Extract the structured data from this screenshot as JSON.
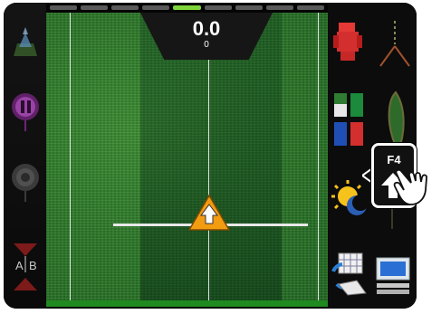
{
  "status": {
    "speed_value": "0.0",
    "speed_sub": "0"
  },
  "left_buttons": [
    {
      "name": "guidance-mode-icon",
      "color": "#6aa84f"
    },
    {
      "name": "pause-record-icon",
      "color": "#7b2a8a"
    },
    {
      "name": "record-icon",
      "color": "#6b6b6b"
    },
    {
      "name": "ab-line-icon",
      "label_a": "A",
      "label_b": "B",
      "color": "#c0392b"
    }
  ],
  "right_buttons": [
    {
      "name": "tractor-icon",
      "color": "#d32f2f"
    },
    {
      "name": "guidance-pattern-icon"
    },
    {
      "name": "section-colors-icon"
    },
    {
      "name": "field-boundary-icon"
    },
    {
      "name": "day-night-icon"
    },
    {
      "name": "grid-sync-icon"
    },
    {
      "name": "monitor-icon"
    }
  ],
  "segments": [
    {
      "active": false
    },
    {
      "active": false
    },
    {
      "active": false
    },
    {
      "active": false
    },
    {
      "active": true
    },
    {
      "active": false
    },
    {
      "active": false
    },
    {
      "active": false
    },
    {
      "active": false
    }
  ],
  "callout": {
    "key_label": "F4",
    "icon": "arrow-up-icon",
    "hand_icon": "pointing-hand-icon"
  },
  "colors": {
    "field_green": "#2e7a2a",
    "marker_orange": "#f39c12",
    "bottom_bar": "#1f8a1f",
    "active_segment": "#7fd43a"
  }
}
